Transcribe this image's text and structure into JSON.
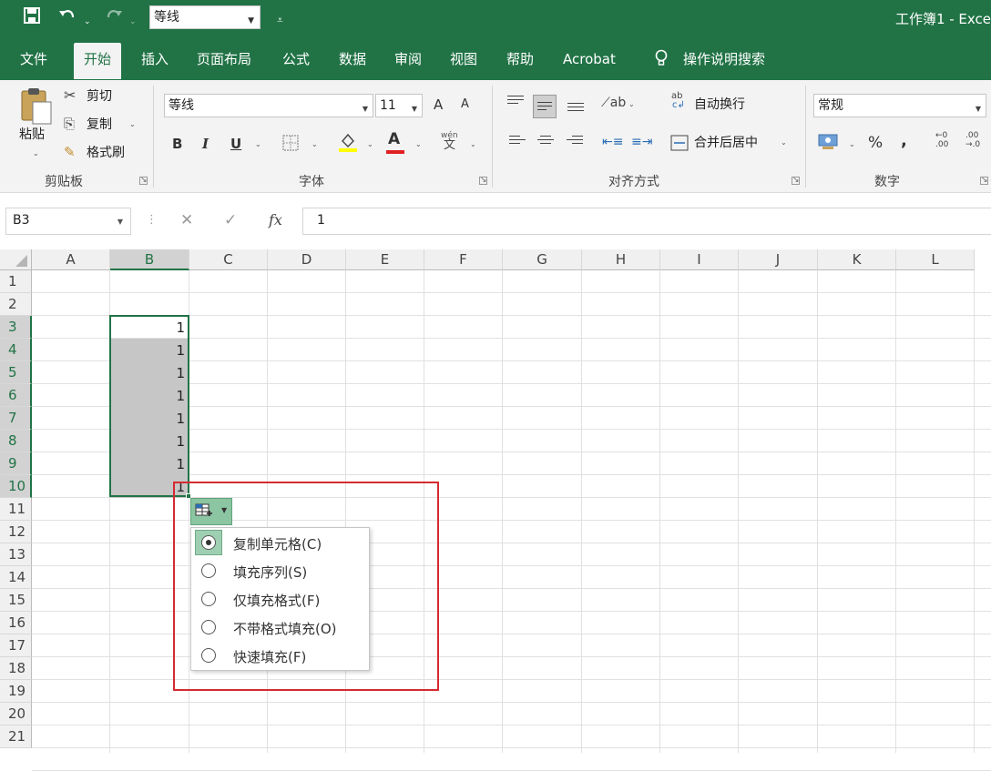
{
  "titlebar": {
    "font_combo": "等线",
    "title": "工作簿1 - Exce"
  },
  "tabs": [
    "文件",
    "开始",
    "插入",
    "页面布局",
    "公式",
    "数据",
    "审阅",
    "视图",
    "帮助",
    "Acrobat",
    "操作说明搜索"
  ],
  "ribbon": {
    "clipboard": {
      "paste": "粘贴",
      "cut": "剪切",
      "copy": "复制",
      "format_painter": "格式刷",
      "group": "剪贴板"
    },
    "font": {
      "name": "等线",
      "size": "11",
      "grow": "A",
      "shrink": "A",
      "bold": "B",
      "italic": "I",
      "underline": "U",
      "color_letter": "A",
      "phonetic_top": "wén",
      "phonetic_bottom": "文",
      "group": "字体"
    },
    "alignment": {
      "wrap": "自动换行",
      "merge": "合并后居中",
      "group": "对齐方式",
      "wrap_icon": "ab"
    },
    "number": {
      "format": "常规",
      "percent": "%",
      "comma": ",",
      "group": "数字",
      "inc_decimal": "←0\n.00",
      "dec_decimal": ".00\n→.0"
    }
  },
  "formula": {
    "namebox": "B3",
    "fx": "fx",
    "value": "1",
    "cancel": "✕",
    "enter": "✓"
  },
  "columns": [
    "A",
    "B",
    "C",
    "D",
    "E",
    "F",
    "G",
    "H",
    "I",
    "J",
    "K",
    "L"
  ],
  "rows": [
    "1",
    "2",
    "3",
    "4",
    "5",
    "6",
    "7",
    "8",
    "9",
    "10",
    "11",
    "12",
    "13",
    "14",
    "15",
    "16",
    "17",
    "18",
    "19",
    "20",
    "21"
  ],
  "cells": {
    "B3": "1",
    "B4": "1",
    "B5": "1",
    "B6": "1",
    "B7": "1",
    "B8": "1",
    "B9": "1",
    "B10": "1"
  },
  "autofill_menu": {
    "items": [
      {
        "label": "复制单元格(C)",
        "checked": true
      },
      {
        "label": "填充序列(S)",
        "checked": false
      },
      {
        "label": "仅填充格式(F)",
        "checked": false
      },
      {
        "label": "不带格式填充(O)",
        "checked": false
      },
      {
        "label": "快速填充(F)",
        "checked": false
      }
    ]
  },
  "colors": {
    "accent": "#217346",
    "highlight_annotation": "#d42b31",
    "font_color": "#e02020",
    "highlight_color": "#ffff00"
  }
}
